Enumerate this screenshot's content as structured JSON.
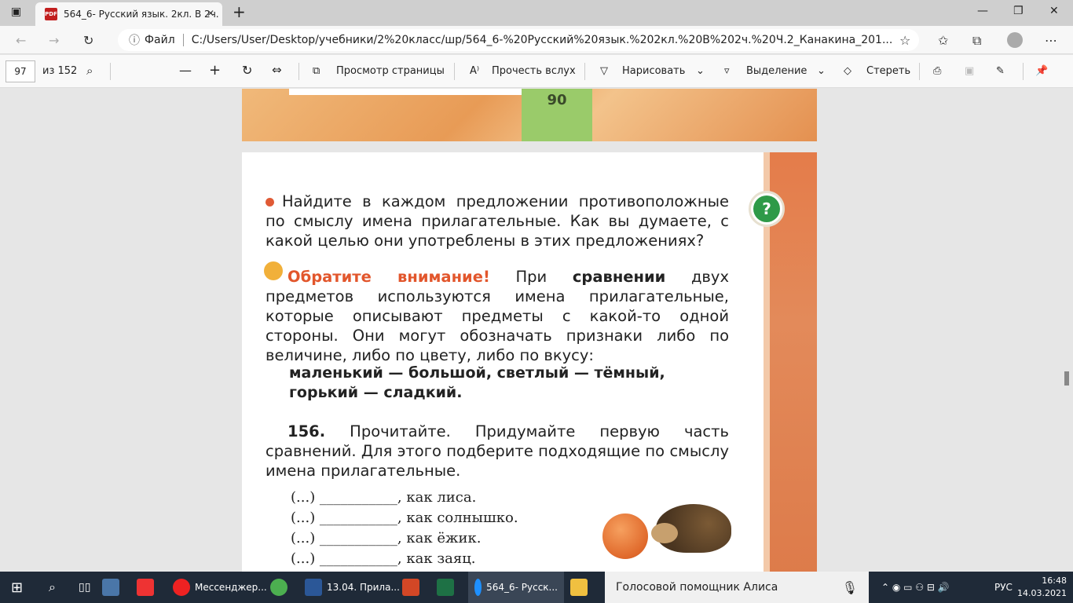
{
  "browser": {
    "tab_title": "564_6- Русский язык. 2кл. В 2ч.",
    "tab_close": "✕",
    "new_tab": "+",
    "min": "—",
    "max": "❐",
    "close": "✕",
    "addr_label": "Файл",
    "url": "C:/Users/User/Desktop/учебники/2%20класс/шр/564_6-%20Русский%20язык.%202кл.%20В%202ч.%20Ч.2_Канакина_201..."
  },
  "pdf_toolbar": {
    "page_number": "97",
    "page_total": "из 152",
    "page_view": "Просмотр страницы",
    "read_aloud": "Прочесть вслух",
    "draw": "Нарисовать",
    "highlight": "Выделение",
    "erase": "Стереть"
  },
  "prev_page_number": "90",
  "content": {
    "task_text": "Найдите в каждом предложении противоположные по смыслу имена прилагательные. Как вы думаете, с какой целью они употреблены в этих предложениях?",
    "note_label": "Обратите внимание!",
    "note_pre": "При",
    "note_bold": "сравнении",
    "note_post": "двух предметов используются имена прилагательные, которые описывают предметы с какой-то одной стороны. Они могут обозначать признаки либо по величине, либо по цвету, либо по вкусу:",
    "examples_line1": "маленький — большой, светлый — тёмный,",
    "examples_line2": "горький — сладкий.",
    "exercise_number": "156.",
    "exercise_text": "Прочитайте. Придумайте первую часть сравнений. Для этого подберите подходящие по смыслу имена прилагательные.",
    "lines": [
      "(...) ___________, как лиса.",
      "(...) ___________, как солнышко.",
      "(...) ___________, как ёжик.",
      "(...) ___________, как заяц."
    ]
  },
  "taskbar": {
    "messenger": "Мессенджер...",
    "word_doc": "13.04. Прила...",
    "edge": "564_6- Русск...",
    "alice": "Голосовой помощник Алиса",
    "lang": "РУС",
    "time": "16:48",
    "date": "14.03.2021"
  }
}
